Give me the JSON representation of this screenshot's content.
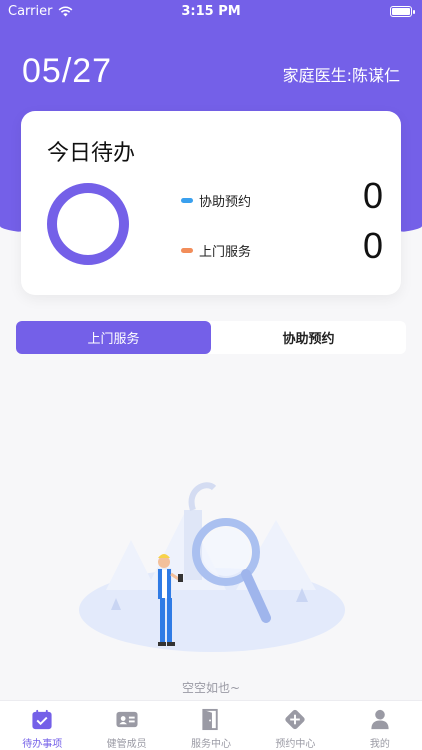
{
  "status_bar": {
    "carrier": "Carrier",
    "time": "3:15 PM"
  },
  "header": {
    "date": "05/27",
    "doctor_label": "家庭医生:陈谋仁"
  },
  "summary_card": {
    "title": "今日待办",
    "items": [
      {
        "label": "协助预约",
        "count": "0",
        "color": "#3aa0ee"
      },
      {
        "label": "上门服务",
        "count": "0",
        "color": "#f28d5a"
      }
    ]
  },
  "segment_tabs": [
    {
      "label": "上门服务",
      "active": true
    },
    {
      "label": "协助预约",
      "active": false
    }
  ],
  "empty_state": {
    "text": "空空如也~"
  },
  "tabbar": [
    {
      "label": "待办事项",
      "icon": "calendar-check-icon",
      "active": true
    },
    {
      "label": "健管成员",
      "icon": "id-card-icon",
      "active": false
    },
    {
      "label": "服务中心",
      "icon": "door-icon",
      "active": false
    },
    {
      "label": "预约中心",
      "icon": "plus-diamond-icon",
      "active": false
    },
    {
      "label": "我的",
      "icon": "person-icon",
      "active": false
    }
  ],
  "colors": {
    "accent": "#7460e8",
    "background": "#f7f7f9"
  }
}
